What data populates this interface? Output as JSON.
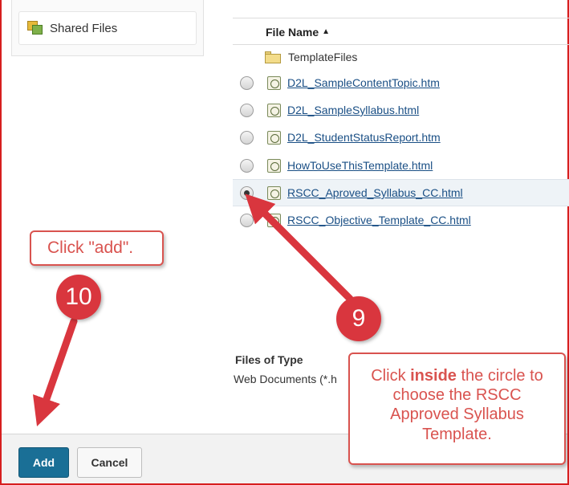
{
  "sidebar": {
    "shared_files_label": "Shared Files",
    "shared_files_icon": "shared-files-icon"
  },
  "file_list": {
    "column_header": "File Name",
    "sort_indicator": "▲",
    "folder": {
      "label": "TemplateFiles",
      "icon": "folder-icon"
    },
    "files": [
      {
        "name": "D2L_SampleContentTopic.htm",
        "selected": false
      },
      {
        "name": "D2L_SampleSyllabus.html",
        "selected": false
      },
      {
        "name": "D2L_StudentStatusReport.htm",
        "selected": false
      },
      {
        "name": "HowToUseThisTemplate.html",
        "selected": false
      },
      {
        "name": "RSCC_Aproved_Syllabus_CC.html",
        "selected": true
      },
      {
        "name": "RSCC_Objective_Template_CC.html",
        "selected": false
      }
    ]
  },
  "files_of_type": {
    "label": "Files of Type",
    "value": "Web Documents (*.h"
  },
  "actions": {
    "add_label": "Add",
    "cancel_label": "Cancel"
  },
  "annotations": {
    "step_10": "10",
    "step_9": "9",
    "callout_add": "Click \"add\".",
    "callout_circle_pre": "Click ",
    "callout_circle_bold": "inside",
    "callout_circle_post": " the circle to choose the RSCC Approved Syllabus Template."
  },
  "colors": {
    "annotation_red": "#d9534f",
    "badge_red": "#d9363e",
    "add_button": "#1a6f96",
    "link": "#1a4f85"
  }
}
